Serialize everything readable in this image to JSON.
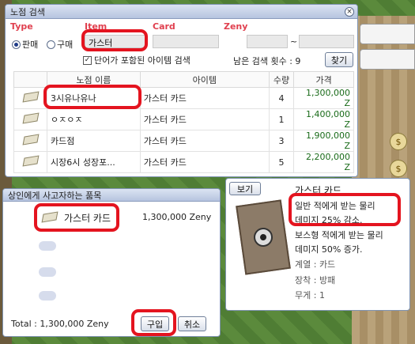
{
  "search_window": {
    "title": "노점 검색",
    "labels": {
      "type": "Type",
      "item": "Item",
      "card": "Card",
      "zeny": "Zeny"
    },
    "radio_sell": "판매",
    "radio_buy": "구매",
    "item_value": "가스터",
    "zeny_sep": "~",
    "checkbox_label": "단어가 포함된 아이템 검색",
    "remaining_label": "남은 검색 횟수 : 9",
    "find_button": "찾기",
    "columns": [
      "노점 이름",
      "아이템",
      "수량",
      "가격"
    ],
    "rows": [
      {
        "shop": "3시유나유나",
        "item": "가스터 카드",
        "qty": "4",
        "price": "1,300,000 Z"
      },
      {
        "shop": "ㅇㅈㅇㅈ",
        "item": "가스터 카드",
        "qty": "1",
        "price": "1,400,000 Z"
      },
      {
        "shop": "카드점",
        "item": "가스터 카드",
        "qty": "3",
        "price": "1,900,000 Z"
      },
      {
        "shop": "시장6시 성장포...",
        "item": "가스터 카드",
        "qty": "5",
        "price": "2,200,000 Z"
      }
    ]
  },
  "buy_window": {
    "title": "상인에게 사고자하는 품목",
    "item_name": "가스터 카드",
    "item_price": "1,300,000 Zeny",
    "total": "Total : 1,300,000 Zeny",
    "buy_button": "구입",
    "cancel_button": "취소"
  },
  "info_window": {
    "view_button": "보기",
    "title": "가스터 카드",
    "lines": [
      "일반 적에게 받는 물리",
      "데미지 25% 감소.",
      "보스형 적에게 받는 물리",
      "데미지 50% 증가.",
      "계열 : 카드",
      "장착 : 방패",
      "무게 : 1"
    ]
  },
  "colors": {
    "accent_red": "#e4141f",
    "label_red": "#e0404f",
    "price_green": "#1a6b1a"
  },
  "icons": [
    "close-icon",
    "card-icon",
    "money-bag-icon"
  ]
}
